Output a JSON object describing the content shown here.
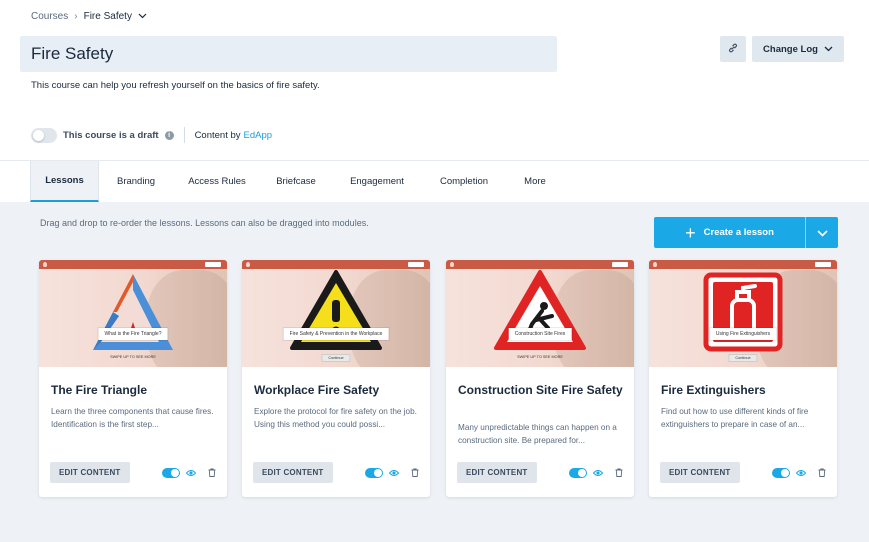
{
  "breadcrumb": {
    "root": "Courses",
    "current": "Fire Safety"
  },
  "course": {
    "title": "Fire Safety",
    "description": "This course can help you refresh yourself on the basics of fire safety."
  },
  "header_actions": {
    "change_log": "Change Log"
  },
  "draft": {
    "label": "This course is a draft",
    "content_by_prefix": "Content by",
    "content_by_link": "EdApp"
  },
  "tabs": [
    "Lessons",
    "Branding",
    "Access Rules",
    "Briefcase",
    "Engagement",
    "Completion",
    "More"
  ],
  "lessons_panel": {
    "hint": "Drag and drop to re-order the lessons. Lessons can also be dragged into modules.",
    "create_label": "Create a lesson"
  },
  "lessons": [
    {
      "title": "The Fire Triangle",
      "description": "Learn the three components that cause fires. Identification is the first step...",
      "thumb_caption": "What is the Fire Triangle?",
      "thumb_footer": "SWIPE UP TO SEE MORE",
      "edit_label": "EDIT CONTENT"
    },
    {
      "title": "Workplace Fire Safety",
      "description": "Explore the protocol for fire safety on the job. Using this method you could possi...",
      "thumb_caption": "Fire Safety & Prevention in the Workplace",
      "thumb_footer": "Continue",
      "edit_label": "EDIT CONTENT"
    },
    {
      "title": "Construction Site Fire Safety",
      "description": "Many unpredictable things can happen on a construction site. Be prepared for...",
      "thumb_caption": "Construction Site Fires",
      "thumb_footer": "SWIPE UP TO SEE MORE",
      "edit_label": "EDIT CONTENT"
    },
    {
      "title": "Fire Extinguishers",
      "description": "Find out how to use different kinds of fire extinguishers to prepare in case of an...",
      "thumb_caption": "Using Fire Extinguishers",
      "thumb_footer": "Continue",
      "edit_label": "EDIT CONTENT"
    }
  ],
  "colors": {
    "accent": "#1aa9e6",
    "title_bg": "#e8eef5",
    "panel_bg": "#eef2f6",
    "fire_red": "#d32a2a"
  }
}
